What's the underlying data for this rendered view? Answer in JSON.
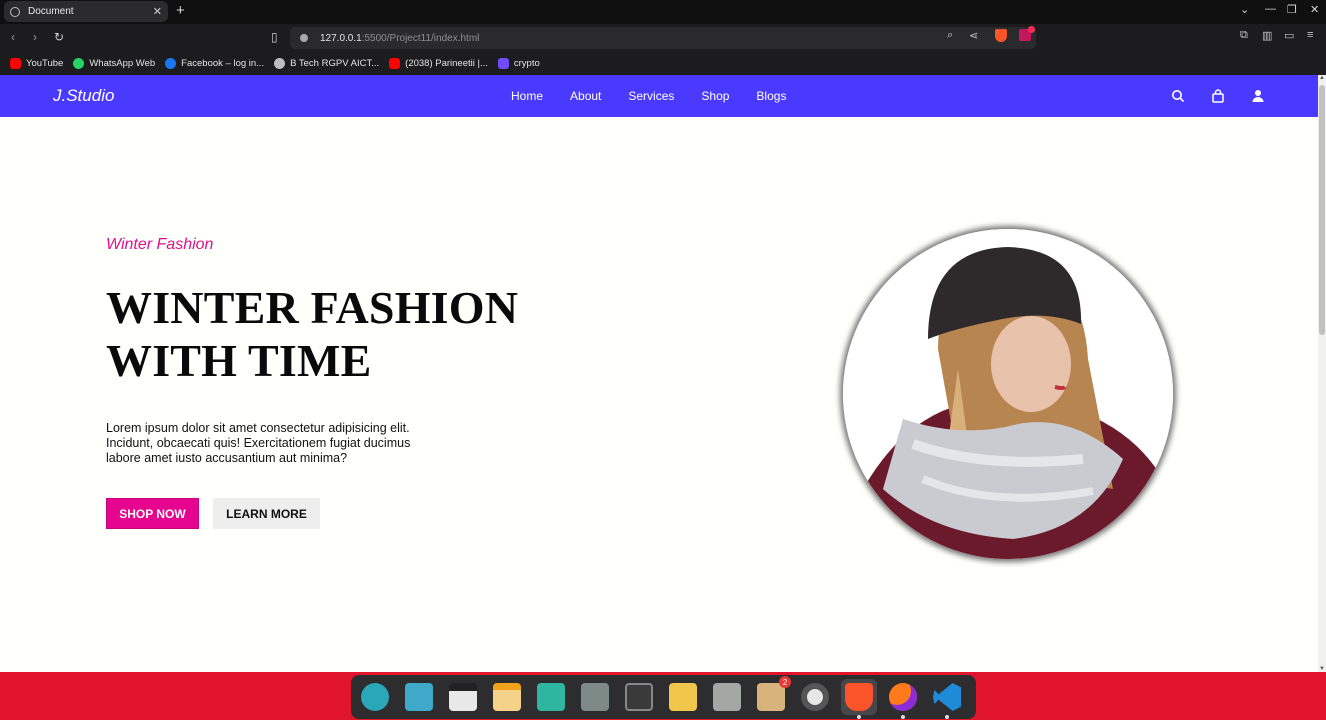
{
  "browser": {
    "tab_title": "Document",
    "tab_close": "✕",
    "new_tab": "+",
    "url_host": "127.0.0.1",
    "url_rest": ":5500/Project11/index.html",
    "window_controls": [
      "⌄",
      "—",
      "❐",
      "✕"
    ]
  },
  "bookmarks": [
    {
      "label": "YouTube",
      "color": "#ff0000"
    },
    {
      "label": "WhatsApp Web",
      "color": "#25d366"
    },
    {
      "label": "Facebook – log in...",
      "color": "#1877f2"
    },
    {
      "label": "B Tech RGPV AICT...",
      "color": "#bdbdbd"
    },
    {
      "label": "(2038) Parineetii |...",
      "color": "#ff0000"
    },
    {
      "label": "crypto",
      "color": "#6f4cff"
    }
  ],
  "site": {
    "logo": "J.Studio",
    "nav": [
      "Home",
      "About",
      "Services",
      "Shop",
      "Blogs"
    ],
    "header_color": "#4a3aff",
    "icons": [
      "search-icon",
      "bag-icon",
      "user-icon"
    ]
  },
  "hero": {
    "tag": "Winter Fashion",
    "title_line1": "WINTER FASHION",
    "title_line2": "WITH TIME",
    "text": "Lorem ipsum dolor sit amet consectetur adipisicing elit. Incidunt, obcaecati quis! Exercitationem fugiat ducimus labore amet iusto accusantium aut minima?",
    "btn_primary": "SHOP NOW",
    "btn_secondary": "LEARN MORE",
    "accent_color": "#e6058f"
  },
  "dock": {
    "apps": [
      "search-app",
      "files-manager",
      "video-app",
      "calendar-app",
      "contacts-app",
      "calculator-app",
      "terminal-app",
      "mail-app",
      "folder-app",
      "archive-app",
      "settings-app",
      "brave-browser",
      "firefox-browser",
      "vscode-editor"
    ],
    "archive_badge": "2"
  }
}
